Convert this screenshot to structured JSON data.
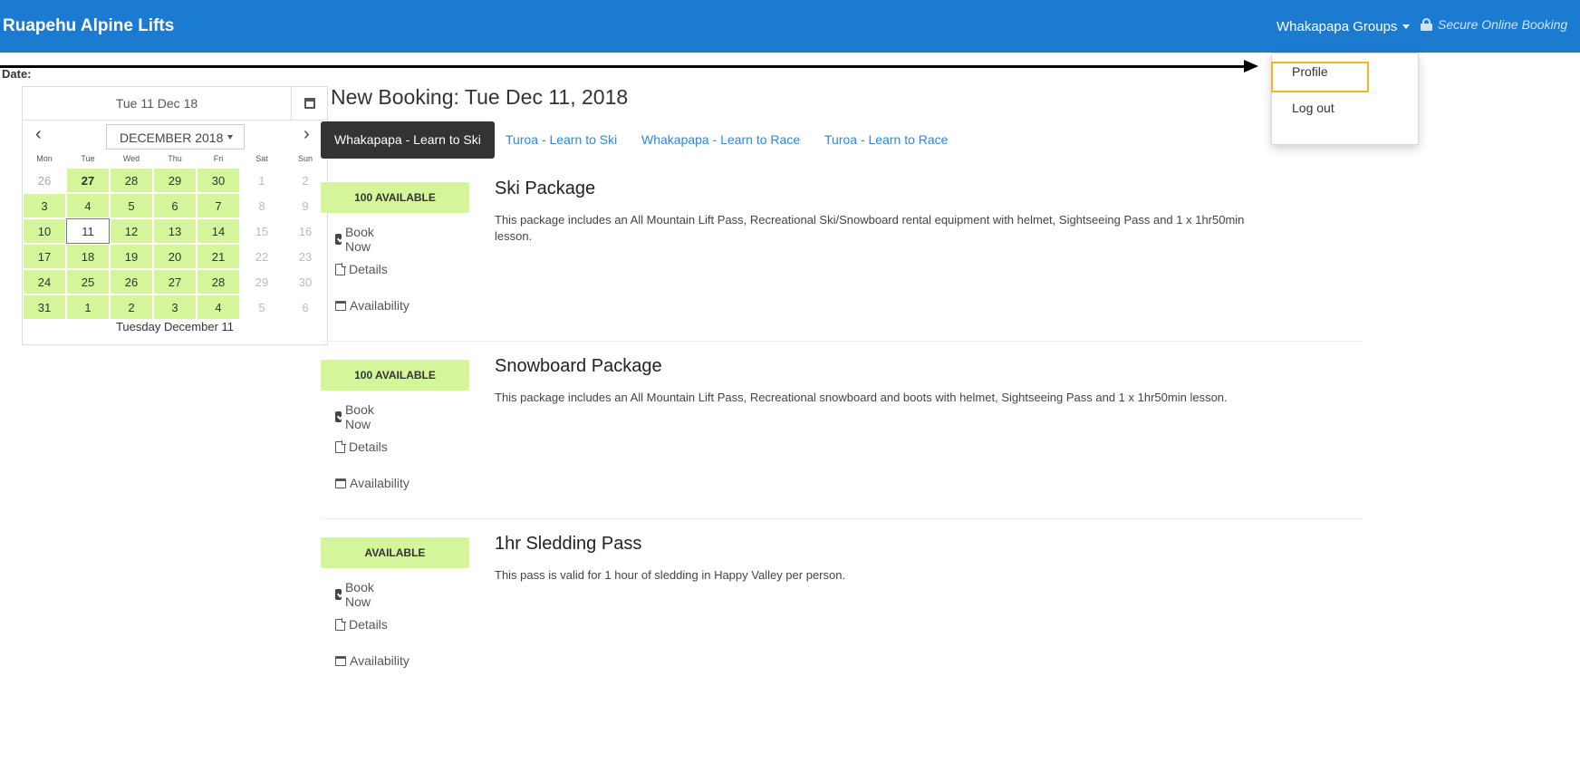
{
  "header": {
    "brand": "Ruapehu Alpine Lifts",
    "groups_label": "Whakapapa Groups",
    "secure_label": "Secure Online Booking"
  },
  "dropdown": {
    "items": [
      {
        "label": "Profile"
      },
      {
        "label": "Log out"
      }
    ]
  },
  "calendar": {
    "date_label": "Date:",
    "input_value": "Tue 11 Dec 18",
    "month_label": "DECEMBER 2018",
    "prev_symbol": "‹",
    "next_symbol": "›",
    "weekdays": [
      "Mon",
      "Tue",
      "Wed",
      "Thu",
      "Fri",
      "Sat",
      "Sun"
    ],
    "days": [
      {
        "d": "26",
        "s": "other"
      },
      {
        "d": "27",
        "s": "avail bold"
      },
      {
        "d": "28",
        "s": "avail"
      },
      {
        "d": "29",
        "s": "avail"
      },
      {
        "d": "30",
        "s": "avail"
      },
      {
        "d": "1",
        "s": "weekend"
      },
      {
        "d": "2",
        "s": "weekend"
      },
      {
        "d": "3",
        "s": "avail"
      },
      {
        "d": "4",
        "s": "avail"
      },
      {
        "d": "5",
        "s": "avail"
      },
      {
        "d": "6",
        "s": "avail"
      },
      {
        "d": "7",
        "s": "avail"
      },
      {
        "d": "8",
        "s": "weekend"
      },
      {
        "d": "9",
        "s": "weekend"
      },
      {
        "d": "10",
        "s": "avail"
      },
      {
        "d": "11",
        "s": "selected"
      },
      {
        "d": "12",
        "s": "avail"
      },
      {
        "d": "13",
        "s": "avail"
      },
      {
        "d": "14",
        "s": "avail"
      },
      {
        "d": "15",
        "s": "weekend"
      },
      {
        "d": "16",
        "s": "weekend"
      },
      {
        "d": "17",
        "s": "avail"
      },
      {
        "d": "18",
        "s": "avail"
      },
      {
        "d": "19",
        "s": "avail"
      },
      {
        "d": "20",
        "s": "avail"
      },
      {
        "d": "21",
        "s": "avail"
      },
      {
        "d": "22",
        "s": "weekend"
      },
      {
        "d": "23",
        "s": "weekend"
      },
      {
        "d": "24",
        "s": "avail"
      },
      {
        "d": "25",
        "s": "avail"
      },
      {
        "d": "26",
        "s": "avail"
      },
      {
        "d": "27",
        "s": "avail"
      },
      {
        "d": "28",
        "s": "avail"
      },
      {
        "d": "29",
        "s": "weekend"
      },
      {
        "d": "30",
        "s": "weekend"
      },
      {
        "d": "31",
        "s": "avail"
      },
      {
        "d": "1",
        "s": "avail"
      },
      {
        "d": "2",
        "s": "avail"
      },
      {
        "d": "3",
        "s": "avail"
      },
      {
        "d": "4",
        "s": "avail"
      },
      {
        "d": "5",
        "s": "weekend"
      },
      {
        "d": "6",
        "s": "weekend"
      }
    ],
    "footer": "Tuesday December 11"
  },
  "main": {
    "title": "New Booking:  Tue Dec 11, 2018",
    "tabs": [
      {
        "label": "Whakapapa - Learn to Ski"
      },
      {
        "label": "Turoa - Learn to Ski"
      },
      {
        "label": "Whakapapa - Learn to Race"
      },
      {
        "label": "Turoa - Learn to Race"
      }
    ],
    "packages": [
      {
        "availability": "100 AVAILABLE",
        "title": "Ski Package",
        "description": "This package includes an All Mountain Lift Pass, Recreational Ski/Snowboard rental equipment with helmet, Sightseeing Pass and 1 x 1hr50min lesson.",
        "book_label": "Book Now",
        "details_label": "Details",
        "availability_label": "Availability"
      },
      {
        "availability": "100 AVAILABLE",
        "title": "Snowboard Package",
        "description": "This package includes an All Mountain Lift Pass, Recreational snowboard and boots with helmet, Sightseeing Pass and 1 x 1hr50min lesson.",
        "book_label": "Book Now",
        "details_label": "Details",
        "availability_label": "Availability"
      },
      {
        "availability": "AVAILABLE",
        "title": "1hr Sledding Pass",
        "description": "This pass is valid for 1 hour of sledding in Happy Valley per person.",
        "book_label": "Book Now",
        "details_label": "Details",
        "availability_label": "Availability"
      }
    ]
  },
  "colors": {
    "header": "#1a7bd1",
    "available": "#d4f59a",
    "active_tab": "#333333",
    "link": "#2b88d8",
    "highlight": "#f2b324"
  }
}
